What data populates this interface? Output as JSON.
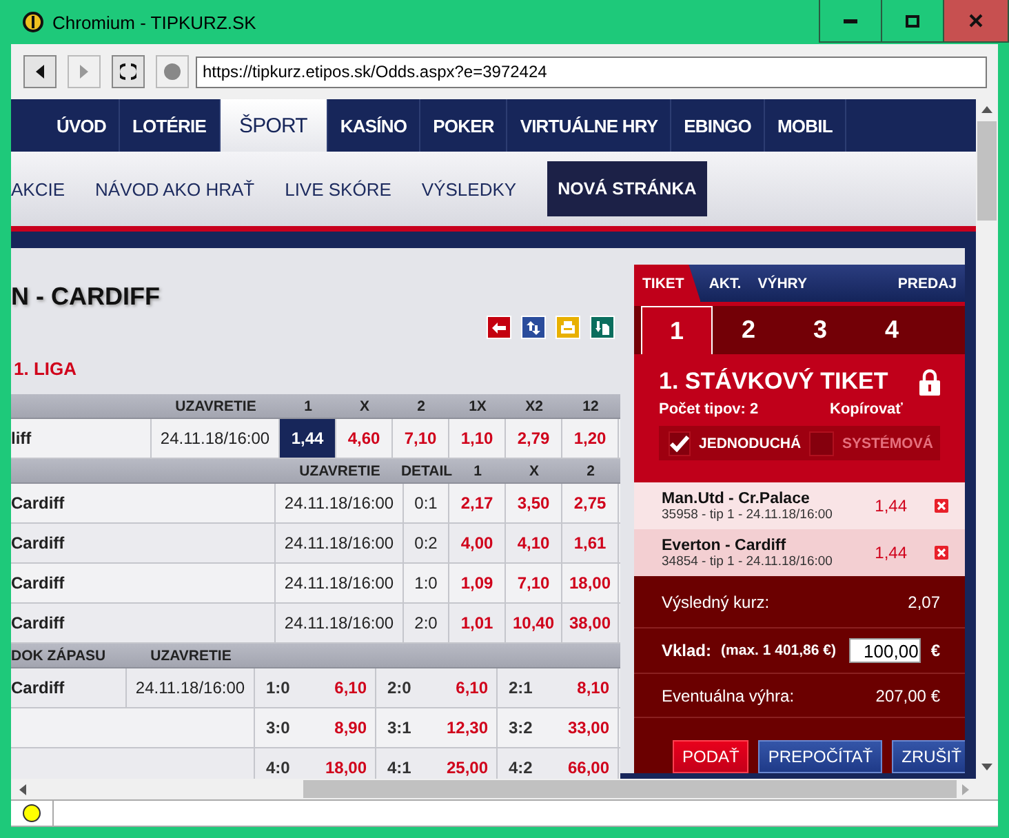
{
  "window": {
    "title": "Chromium - TIPKURZ.SK"
  },
  "toolbar": {
    "url": "https://tipkurz.etipos.sk/Odds.aspx?e=3972424"
  },
  "main_nav": [
    {
      "label": "ÚVOD",
      "selected": false
    },
    {
      "label": "LOTÉRIE",
      "selected": false
    },
    {
      "label": "ŠPORT",
      "selected": true
    },
    {
      "label": "KASÍNO",
      "selected": false
    },
    {
      "label": "POKER",
      "selected": false
    },
    {
      "label": "VIRTUÁLNE HRY",
      "selected": false
    },
    {
      "label": "EBINGO",
      "selected": false
    },
    {
      "label": "MOBIL",
      "selected": false
    }
  ],
  "sub_nav": [
    {
      "label": "AKCIE",
      "selected": false
    },
    {
      "label": "NÁVOD AKO HRAŤ",
      "selected": false
    },
    {
      "label": "LIVE SKÓRE",
      "selected": false
    },
    {
      "label": "VÝSLEDKY",
      "selected": false
    },
    {
      "label": "NOVÁ STRÁNKA",
      "selected": true
    }
  ],
  "event": {
    "title": "N - CARDIFF",
    "league": "1. LIGA"
  },
  "odds_table": {
    "columns": [
      "UZAVRETIE",
      "1",
      "X",
      "2",
      "1X",
      "X2",
      "12"
    ],
    "rows": [
      {
        "match": "liff",
        "closing": "24.11.18/16:00",
        "odds": [
          {
            "value": "1,44",
            "selected": true
          },
          {
            "value": "4,60",
            "selected": false
          },
          {
            "value": "7,10",
            "selected": false
          },
          {
            "value": "1,10",
            "selected": false
          },
          {
            "value": "2,79",
            "selected": false
          },
          {
            "value": "1,20",
            "selected": false
          }
        ]
      }
    ]
  },
  "handicap_table": {
    "columns": [
      "UZAVRETIE",
      "DETAIL",
      "1",
      "X",
      "2"
    ],
    "rows": [
      {
        "match": "Cardiff",
        "closing": "24.11.18/16:00",
        "detail": "0:1",
        "odds": [
          "2,17",
          "3,50",
          "2,75"
        ]
      },
      {
        "match": "Cardiff",
        "closing": "24.11.18/16:00",
        "detail": "0:2",
        "odds": [
          "4,00",
          "4,10",
          "1,61"
        ]
      },
      {
        "match": "Cardiff",
        "closing": "24.11.18/16:00",
        "detail": "1:0",
        "odds": [
          "1,09",
          "7,10",
          "18,00"
        ]
      },
      {
        "match": "Cardiff",
        "closing": "24.11.18/16:00",
        "detail": "2:0",
        "odds": [
          "1,01",
          "10,40",
          "38,00"
        ]
      }
    ]
  },
  "score_table": {
    "columns": [
      "DOK ZÁPASU",
      "UZAVRETIE"
    ],
    "rows": [
      {
        "match": "Cardiff",
        "closing": "24.11.18/16:00",
        "scores": [
          {
            "score": "1:0",
            "odds": "6,10"
          },
          {
            "score": "2:0",
            "odds": "6,10"
          },
          {
            "score": "2:1",
            "odds": "8,10"
          }
        ]
      },
      {
        "scores": [
          {
            "score": "3:0",
            "odds": "8,90"
          },
          {
            "score": "3:1",
            "odds": "12,30"
          },
          {
            "score": "3:2",
            "odds": "33,00"
          }
        ]
      },
      {
        "scores": [
          {
            "score": "4:0",
            "odds": "18,00"
          },
          {
            "score": "4:1",
            "odds": "25,00"
          },
          {
            "score": "4:2",
            "odds": "66,00"
          }
        ]
      }
    ]
  },
  "ticket": {
    "tabs": [
      {
        "label": "TIKET",
        "selected": true
      },
      {
        "label": "AKT.",
        "selected": false
      },
      {
        "label": "VÝHRY",
        "selected": false
      },
      {
        "label": "PREDAJ",
        "selected": false
      }
    ],
    "numbers": [
      {
        "label": "1",
        "selected": true
      },
      {
        "label": "2",
        "selected": false
      },
      {
        "label": "3",
        "selected": false
      },
      {
        "label": "4",
        "selected": false
      }
    ],
    "title": "1. STÁVKOVÝ TIKET",
    "tip_count": "Počet tipov: 2",
    "copy": "Kopírovať",
    "bet_types": [
      {
        "label": "JEDNODUCHÁ",
        "checked": true
      },
      {
        "label": "SYSTÉMOVÁ",
        "checked": false
      }
    ],
    "bets": [
      {
        "match": "Man.Utd - Cr.Palace",
        "detail": "35958 - tip 1 - 24.11.18/16:00",
        "odds": "1,44"
      },
      {
        "match": "Everton - Cardiff",
        "detail": "34854 - tip 1 - 24.11.18/16:00",
        "odds": "1,44"
      }
    ],
    "total_odds": {
      "label": "Výsledný kurz:",
      "value": "2,07"
    },
    "stake": {
      "label": "Vklad:",
      "max": "(max. 1 401,86 €)",
      "value": "100,00",
      "currency": "€"
    },
    "potential_win": {
      "label": "Eventuálna výhra:",
      "value": "207,00 €"
    },
    "buttons": [
      {
        "label": "PODAŤ",
        "kind": "primary"
      },
      {
        "label": "PREPOČÍTAŤ",
        "kind": "secondary"
      },
      {
        "label": "ZRUŠIŤ",
        "kind": "secondary"
      }
    ]
  }
}
